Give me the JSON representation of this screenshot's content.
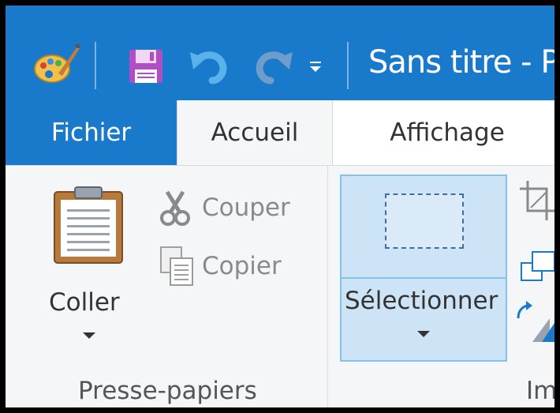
{
  "window": {
    "title": "Sans titre - Pa"
  },
  "quick_access": {
    "app_icon": "paint-palette-icon",
    "save_icon": "floppy-save-icon",
    "undo_icon": "undo-icon",
    "redo_icon": "redo-icon",
    "customize_icon": "customize-dropdown-icon"
  },
  "tabs": [
    {
      "label": "Fichier"
    },
    {
      "label": "Accueil"
    },
    {
      "label": "Affichage"
    }
  ],
  "clipboard": {
    "paste_label": "Coller",
    "cut_label": "Couper",
    "copy_label": "Copier",
    "group_label": "Presse-papiers"
  },
  "image_group": {
    "select_label": "Sélectionner",
    "group_label_partial": "Im"
  },
  "colors": {
    "accent": "#1979ca",
    "ribbon_bg": "#f5f6f7",
    "selected_bg": "#cde4f7",
    "selected_border": "#86c0ec"
  }
}
